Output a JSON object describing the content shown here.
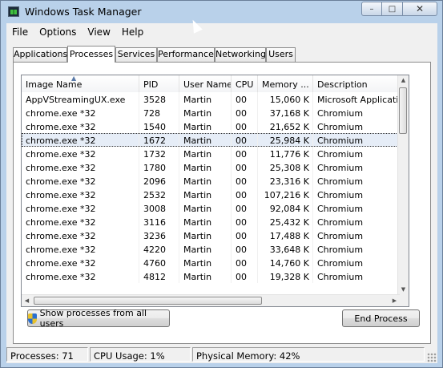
{
  "window": {
    "title": "Windows Task Manager"
  },
  "caption": {
    "minimize": "–",
    "maximize": "□",
    "close": "✕"
  },
  "menu": [
    "File",
    "Options",
    "View",
    "Help"
  ],
  "tabs": [
    {
      "label": "Applications",
      "active": false
    },
    {
      "label": "Processes",
      "active": true
    },
    {
      "label": "Services",
      "active": false
    },
    {
      "label": "Performance",
      "active": false
    },
    {
      "label": "Networking",
      "active": false
    },
    {
      "label": "Users",
      "active": false
    }
  ],
  "table": {
    "columns": [
      "Image Name",
      "PID",
      "User Name",
      "CPU",
      "Memory ...",
      "Description"
    ],
    "sorted_column": "Image Name",
    "selected_row": 3,
    "rows": [
      [
        "AppVStreamingUX.exe",
        "3528",
        "Martin",
        "00",
        "15,060 K",
        "Microsoft Application V"
      ],
      [
        "chrome.exe *32",
        "728",
        "Martin",
        "00",
        "37,168 K",
        "Chromium"
      ],
      [
        "chrome.exe *32",
        "1540",
        "Martin",
        "00",
        "21,652 K",
        "Chromium"
      ],
      [
        "chrome.exe *32",
        "1672",
        "Martin",
        "00",
        "25,984 K",
        "Chromium"
      ],
      [
        "chrome.exe *32",
        "1732",
        "Martin",
        "00",
        "11,776 K",
        "Chromium"
      ],
      [
        "chrome.exe *32",
        "1780",
        "Martin",
        "00",
        "25,308 K",
        "Chromium"
      ],
      [
        "chrome.exe *32",
        "2096",
        "Martin",
        "00",
        "23,316 K",
        "Chromium"
      ],
      [
        "chrome.exe *32",
        "2532",
        "Martin",
        "00",
        "107,216 K",
        "Chromium"
      ],
      [
        "chrome.exe *32",
        "3008",
        "Martin",
        "00",
        "92,084 K",
        "Chromium"
      ],
      [
        "chrome.exe *32",
        "3116",
        "Martin",
        "00",
        "25,432 K",
        "Chromium"
      ],
      [
        "chrome.exe *32",
        "3236",
        "Martin",
        "00",
        "17,488 K",
        "Chromium"
      ],
      [
        "chrome.exe *32",
        "4220",
        "Martin",
        "00",
        "33,648 K",
        "Chromium"
      ],
      [
        "chrome.exe *32",
        "4760",
        "Martin",
        "00",
        "14,760 K",
        "Chromium"
      ],
      [
        "chrome.exe *32",
        "4812",
        "Martin",
        "00",
        "19,328 K",
        "Chromium"
      ]
    ]
  },
  "buttons": {
    "show_all": "Show processes from all users",
    "end_process": "End Process"
  },
  "status": {
    "processes": "Processes: 71",
    "cpu": "CPU Usage: 1%",
    "memory": "Physical Memory: 42%"
  },
  "icons": {
    "app": "task-manager-icon",
    "shield": "uac-shield-icon",
    "sort": "sort-ascending-icon"
  }
}
